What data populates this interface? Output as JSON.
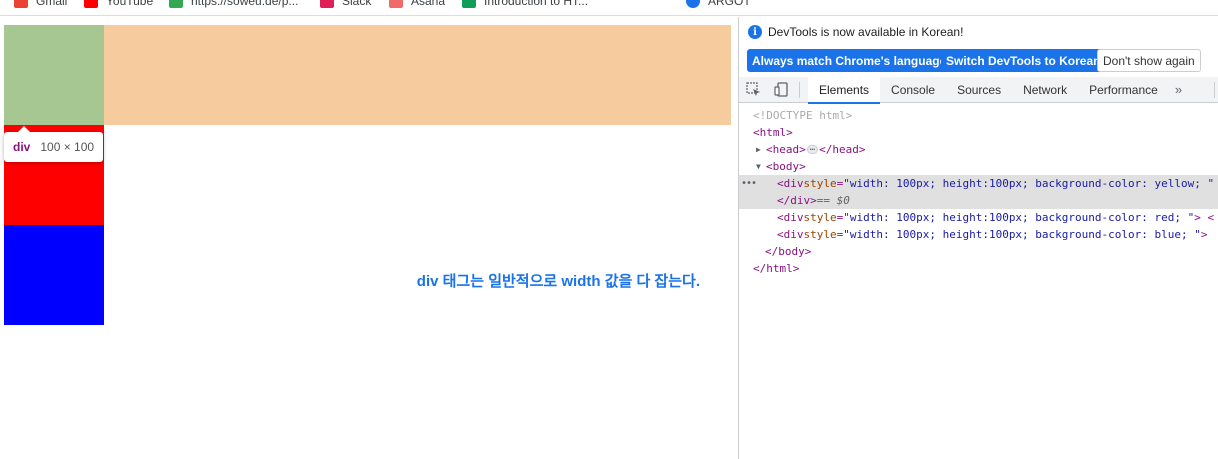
{
  "bookmarks": [
    {
      "label": "Gmail",
      "color": "#ea4335",
      "icon": "gmail-icon"
    },
    {
      "label": "YouTube",
      "color": "#ff0000",
      "icon": "youtube-icon"
    },
    {
      "label": "https://soweu.de/p...",
      "color": "#34a853",
      "icon": "site-icon"
    },
    {
      "label": "Slack",
      "color": "#e01e5a",
      "icon": "slack-icon"
    },
    {
      "label": "Asana",
      "color": "#f06a6a",
      "icon": "asana-icon"
    },
    {
      "label": "Introduction to HT...",
      "color": "#0f9d58",
      "icon": "vuejs-icon"
    },
    {
      "label": "ARGOT",
      "color": "#1a73e8",
      "icon": "argot-icon"
    }
  ],
  "page": {
    "tooltip_tag": "div",
    "tooltip_size": "100 × 100",
    "annotation": "div 태그는 일반적으로 width 값을 다 잡는다.",
    "colors": {
      "highlight_margin": "#f6cb9d",
      "highlight_content": "#a6c792",
      "red": "#ff0000",
      "blue": "#0000ff"
    }
  },
  "devtools": {
    "info_text": "DevTools is now available in Korean!",
    "buttons": {
      "match": "Always match Chrome's language",
      "switch": "Switch DevTools to Korean",
      "dismiss": "Don't show again"
    },
    "tabs": [
      "Elements",
      "Console",
      "Sources",
      "Network",
      "Performance"
    ],
    "more_tabs": "»",
    "code": {
      "doctype": "<!DOCTYPE html>",
      "html_open": "<html>",
      "head_open": "<head>",
      "head_close": "</head>",
      "body_open": "<body>",
      "div1_open": "<div ",
      "div1_attr": "style",
      "div1_val": "\"width: 100px; height:100px; background-color: yellow; \"",
      "div_close": "</div>",
      "dollar0": " == $0",
      "div2_open": "<div ",
      "div2_attr": "style",
      "div2_val": "\"width: 100px; height:100px; background-color: red; \"",
      "div2_end": "> <",
      "div3_open": "<div ",
      "div3_attr": "style",
      "div3_val": "\"width: 100px; height:100px; background-color: blue; \"",
      "div3_end": "> ",
      "body_close": "</body>",
      "html_close": "</html>",
      "ellipsis": "…",
      "sel_dots": "•••"
    }
  }
}
